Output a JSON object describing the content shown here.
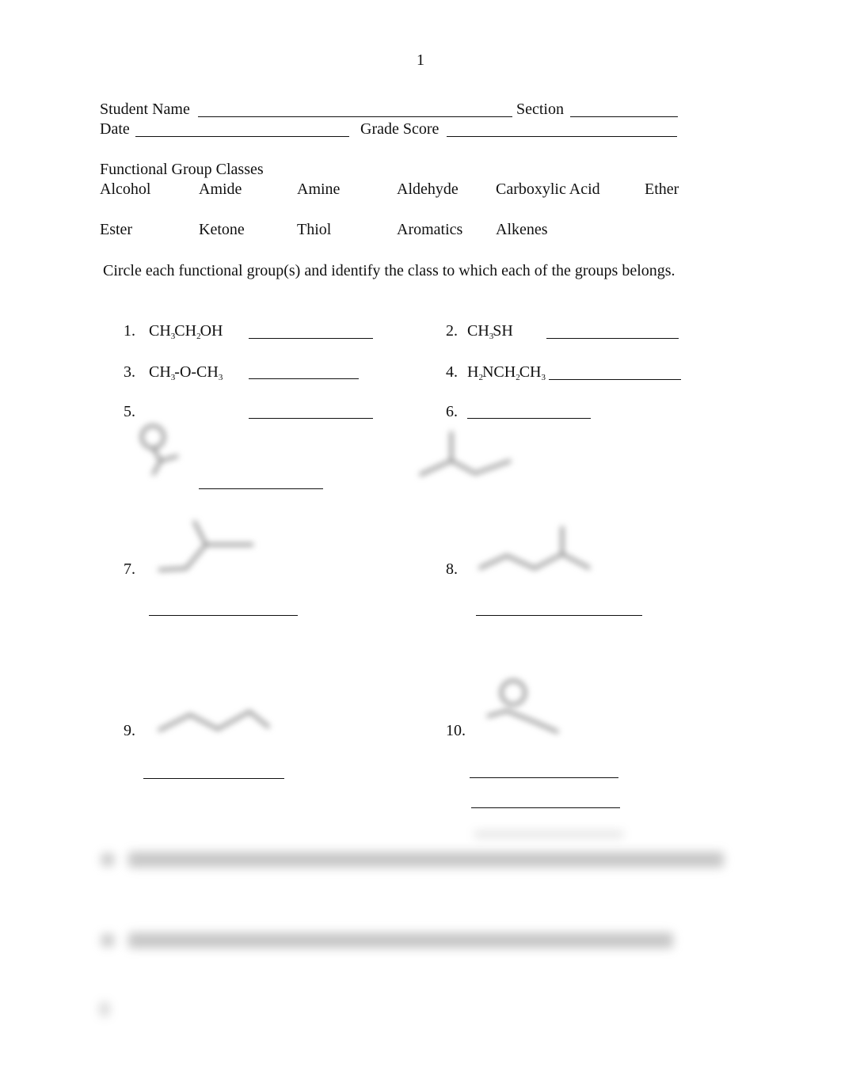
{
  "page_number": "1",
  "header": {
    "student_name_label": "Student Name",
    "section_label": "Section",
    "date_label": "Date",
    "grade_score_label": "Grade Score"
  },
  "classes": {
    "title": "Functional Group Classes",
    "row1": [
      "Alcohol",
      "Amide",
      "Amine",
      "Aldehyde",
      "Carboxylic Acid",
      "Ether"
    ],
    "row2": [
      "Ester",
      "Ketone",
      "Thiol",
      "Aromatics",
      "Alkenes"
    ]
  },
  "instructions": "Circle each functional group(s) and identify the class to which each of the groups belongs.",
  "questions": [
    {
      "num": "1.",
      "formula": [
        [
          "CH",
          ""
        ],
        [
          "3",
          "sub"
        ],
        [
          "CH",
          ""
        ],
        [
          "2",
          "sub"
        ],
        [
          "OH",
          ""
        ]
      ]
    },
    {
      "num": "2.",
      "formula": [
        [
          "CH",
          ""
        ],
        [
          "3",
          "sub"
        ],
        [
          "SH",
          ""
        ]
      ]
    },
    {
      "num": "3.",
      "formula": [
        [
          "CH",
          ""
        ],
        [
          "3",
          "sub"
        ],
        [
          "-O-CH",
          ""
        ],
        [
          "3",
          "sub"
        ]
      ]
    },
    {
      "num": "4.",
      "formula": [
        [
          "H",
          ""
        ],
        [
          "2",
          "sub"
        ],
        [
          "NCH",
          ""
        ],
        [
          "2",
          "sub"
        ],
        [
          "CH",
          ""
        ],
        [
          "3",
          "sub"
        ]
      ]
    },
    {
      "num": "5."
    },
    {
      "num": "6."
    },
    {
      "num": "7."
    },
    {
      "num": "8."
    },
    {
      "num": "9."
    },
    {
      "num": "10."
    }
  ],
  "blurred_content_note": "Questions 11, 12 and footer text are blurred/illegible in the source"
}
